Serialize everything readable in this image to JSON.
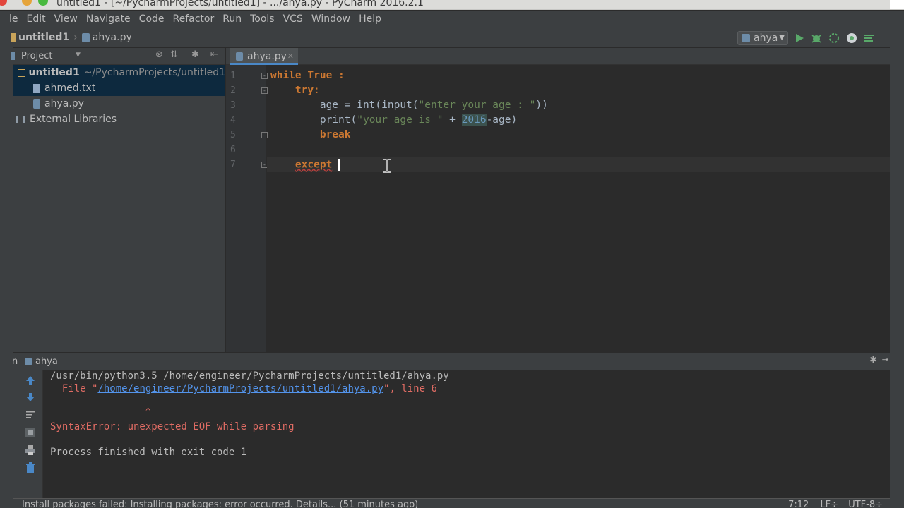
{
  "window": {
    "title": "untitled1 - [~/PycharmProjects/untitled1] - .../ahya.py - PyCharm 2016.2.1"
  },
  "menu": [
    "le",
    "Edit",
    "View",
    "Navigate",
    "Code",
    "Refactor",
    "Run",
    "Tools",
    "VCS",
    "Window",
    "Help"
  ],
  "breadcrumb": {
    "project": "untitled1",
    "file": "ahya.py"
  },
  "toolbar": {
    "run_config": "ahya"
  },
  "project_panel": {
    "header": "Project",
    "root_label": "untitled1",
    "root_path": "~/PycharmProjects/untitled1",
    "files": [
      "ahmed.txt",
      "ahya.py"
    ],
    "external": "External Libraries"
  },
  "editor": {
    "tab": "ahya.py",
    "line_numbers": [
      "1",
      "2",
      "3",
      "4",
      "5",
      "6",
      "7"
    ],
    "code": {
      "l1_kw1": "while",
      "l1_kw2": "True",
      "l1_rest": " :",
      "l2_kw": "try",
      "l2_rest": ":",
      "l3_a": "age = int(input(",
      "l3_str": "\"enter your age : \"",
      "l3_b": "))",
      "l4_a": "print(",
      "l4_str": "\"your age is \"",
      "l4_b": " + ",
      "l4_num": "2016",
      "l4_c": "-age)",
      "l5_kw": "break",
      "l7_kw": "except"
    }
  },
  "run_panel": {
    "tab_prefix": "n",
    "tab_label": "ahya",
    "lines": {
      "cmd": "/usr/bin/python3.5 /home/engineer/PycharmProjects/untitled1/ahya.py",
      "file_prefix": "  File \"",
      "file_link": "/home/engineer/PycharmProjects/untitled1/ahya.py",
      "file_suffix": "\", line 6",
      "caret": "^",
      "error": "SyntaxError: unexpected EOF while parsing",
      "finished": "Process finished with exit code 1"
    }
  },
  "status": {
    "message": "Install packages failed: Installing packages: error occurred. Details...  (51 minutes ago)",
    "position": "7:12",
    "line_sep": "LF÷",
    "encoding": "UTF-8÷"
  },
  "colors": {
    "keyword": "#cc7832",
    "string": "#6a8759",
    "error": "#e06c64",
    "link": "#5394ec"
  }
}
